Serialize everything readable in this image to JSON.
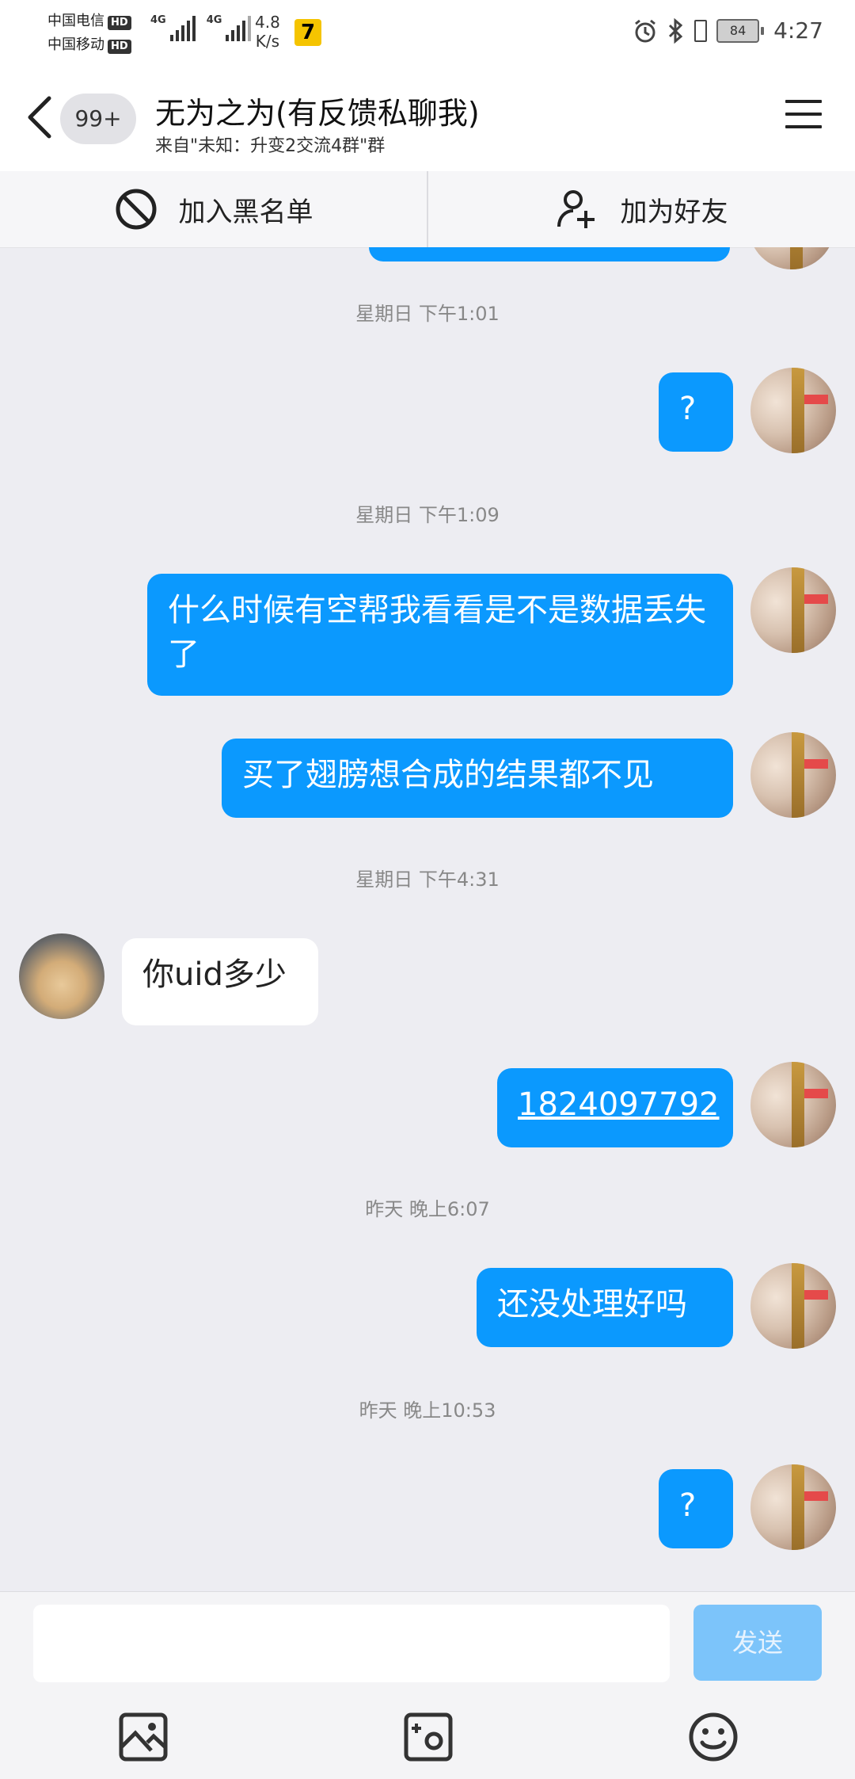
{
  "status_bar": {
    "carrier1": "中国电信",
    "carrier2": "中国移动",
    "hd": "HD",
    "net": "4G",
    "speed_value": "4.8",
    "speed_unit": "K/s",
    "app_badge": "7",
    "battery": "84",
    "time": "4:27"
  },
  "header": {
    "badge": "99+",
    "title": "无为之为(有反馈私聊我)",
    "subtitle": "来自\"未知：升变2交流4群\"群"
  },
  "actions": {
    "blacklist": "加入黑名单",
    "add_friend": "加为好友"
  },
  "chat": {
    "timestamps": [
      "星期日  下午1:01",
      "星期日  下午1:09",
      "星期日  下午4:31",
      "昨天  晚上6:07",
      "昨天  晚上10:53"
    ],
    "messages": [
      {
        "side": "out",
        "text": "?"
      },
      {
        "side": "out",
        "text": "什么时候有空帮我看看是不是数据丢失了"
      },
      {
        "side": "out",
        "text": "买了翅膀想合成的结果都不见"
      },
      {
        "side": "in",
        "text": "你uid多少"
      },
      {
        "side": "out",
        "text": "1824097792"
      },
      {
        "side": "out",
        "text": "还没处理好吗"
      },
      {
        "side": "out",
        "text": "?"
      }
    ]
  },
  "input": {
    "value": "",
    "placeholder": "",
    "send_label": "发送"
  },
  "colors": {
    "outgoing_bubble": "#0b99fe",
    "send_disabled": "#7cc4fa",
    "background": "#ededf2"
  }
}
